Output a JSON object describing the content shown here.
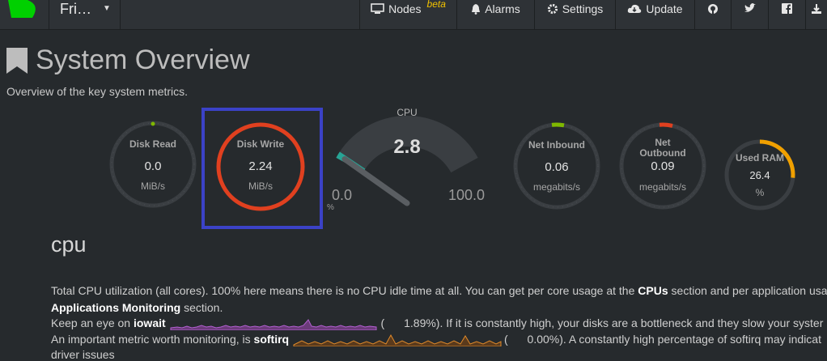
{
  "navbar": {
    "brand": "Fri…",
    "items": [
      {
        "label": "Nodes",
        "badge": "beta",
        "icon": "monitor-icon"
      },
      {
        "label": "Alarms",
        "icon": "bell-icon"
      },
      {
        "label": "Settings",
        "icon": "gear-icon"
      },
      {
        "label": "Update",
        "icon": "cloud-download-icon"
      }
    ],
    "social_icons": [
      "github-icon",
      "twitter-icon",
      "facebook-icon",
      "download-icon"
    ]
  },
  "page": {
    "title": "System Overview",
    "subtitle": "Overview of the key system metrics."
  },
  "gauges": {
    "disk_read": {
      "label": "Disk Read",
      "value": "0.0",
      "unit": "MiB/s",
      "color": "#7fb800"
    },
    "disk_write": {
      "label": "Disk Write",
      "value": "2.24",
      "unit": "MiB/s",
      "color": "#e0401f"
    },
    "cpu": {
      "label": "CPU",
      "value": "2.8",
      "min": "0.0",
      "max": "100.0",
      "unit": "%",
      "color": "#27a495",
      "fraction": 0.028
    },
    "net_inbound": {
      "label": "Net Inbound",
      "value": "0.06",
      "unit": "megabits/s",
      "color": "#7fb800"
    },
    "net_outbound": {
      "label_line1": "Net",
      "label_line2": "Outbound",
      "value": "0.09",
      "unit": "megabits/s",
      "color": "#e0401f"
    },
    "used_ram": {
      "label": "Used RAM",
      "value": "26.4",
      "unit": "%",
      "color": "#f0a000",
      "fraction": 0.264
    }
  },
  "section": {
    "title": "cpu",
    "line1_a": "Total CPU utilization (all cores). 100% here means there is no CPU idle time at all. You can get per core usage at the ",
    "line1_b": "CPUs",
    "line1_c": " section and per application usa",
    "line2_a": "Applications Monitoring",
    "line2_b": " section.",
    "line3_a": "Keep an eye on ",
    "line3_b": "iowait",
    "line3_c": "(",
    "line3_d": "1.89%). If it is constantly high, your disks are a bottleneck and they slow your syster",
    "line4_a": "An important metric worth monitoring, is ",
    "line4_b": "softirq",
    "line4_c": "(",
    "line4_d": "0.00%). A constantly high percentage of softirq may indicat",
    "line5": "driver issues"
  }
}
